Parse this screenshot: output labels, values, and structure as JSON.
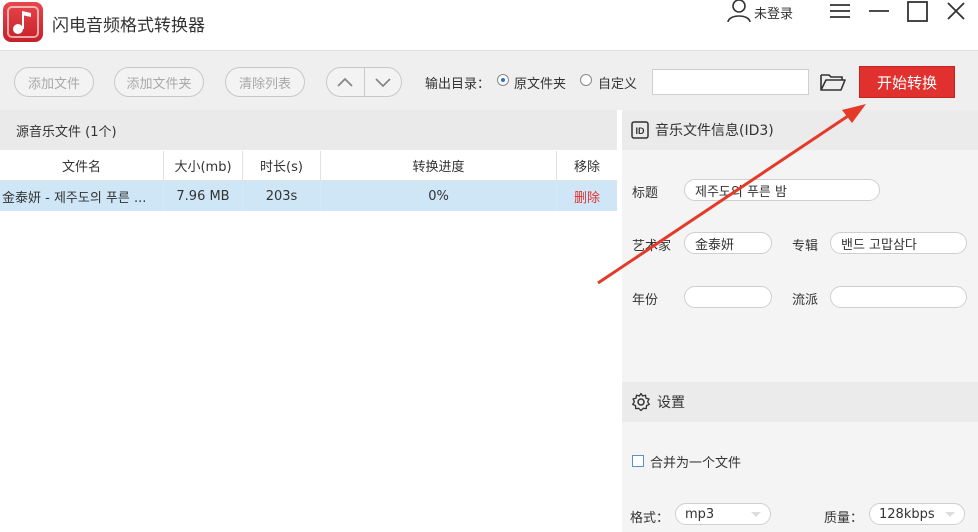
{
  "app": {
    "title": "闪电音频格式转换器",
    "login_label": "未登录"
  },
  "toolbar": {
    "add_file": "添加文件",
    "add_folder": "添加文件夹",
    "clear_list": "清除列表",
    "output_label": "输出目录：",
    "radio_original": "原文件夹",
    "radio_custom": "自定义",
    "output_option_selected": "原文件夹",
    "path_value": "",
    "start_label": "开始转换"
  },
  "file_list": {
    "header": "源音乐文件 (1个)",
    "columns": [
      "文件名",
      "大小(mb)",
      "时长(s)",
      "转换进度",
      "移除"
    ],
    "rows": [
      {
        "name": "金泰妍 - 제주도의 푸른 ...",
        "size": "7.96 MB",
        "duration": "203s",
        "progress": "0%",
        "remove": "删除"
      }
    ]
  },
  "id3": {
    "header": "音乐文件信息(ID3)",
    "labels": {
      "title": "标题",
      "artist": "艺术家",
      "album": "专辑",
      "year": "年份",
      "genre": "流派"
    },
    "values": {
      "title": "제주도의 푸른 밤",
      "artist": "金泰妍",
      "album": "밴드 고맙삼다",
      "year": "",
      "genre": ""
    }
  },
  "settings": {
    "header": "设置",
    "merge_label": "合并为一个文件",
    "merge_checked": false,
    "format_label": "格式：",
    "format_value": "mp3",
    "quality_label": "质量：",
    "quality_value": "128kbps"
  },
  "colors": {
    "accent_red": "#e0312e",
    "selected_row": "#cfe6f7",
    "annotation_arrow": "#e33a2a"
  },
  "icons": {
    "logo": "music-note-icon",
    "user": "user-icon",
    "menu": "menu-icon",
    "minimize": "minimize-icon",
    "maximize": "maximize-icon",
    "close": "close-icon",
    "up": "chevron-up-icon",
    "down": "chevron-down-icon",
    "folder": "folder-open-icon",
    "id3": "id-badge-icon",
    "settings": "gear-icon"
  }
}
